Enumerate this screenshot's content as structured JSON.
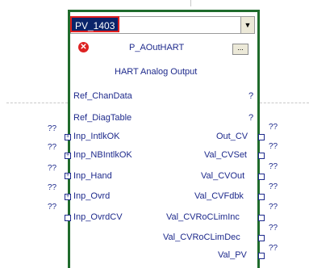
{
  "block": {
    "tag_name": "PV_1403",
    "block_type": "P_AOutHART",
    "description": "HART Analog Output",
    "config_button_label": "...",
    "dropdown_arrow": "▼",
    "error_icon": "x-circle-icon"
  },
  "params": [
    {
      "label": "Ref_ChanData",
      "value": "?"
    },
    {
      "label": "Ref_DiagTable",
      "value": "?"
    }
  ],
  "inputs": [
    {
      "label": "Inp_IntlkOK",
      "wire": "??"
    },
    {
      "label": "Inp_NBIntlkOK",
      "wire": "??"
    },
    {
      "label": "Inp_Hand",
      "wire": "??"
    },
    {
      "label": "Inp_Ovrd",
      "wire": "??"
    },
    {
      "label": "Inp_OvrdCV",
      "wire": "??"
    }
  ],
  "outputs": [
    {
      "label": "Out_CV",
      "wire": "??"
    },
    {
      "label": "Val_CVSet",
      "wire": "??"
    },
    {
      "label": "Val_CVOut",
      "wire": "??"
    },
    {
      "label": "Val_CVFdbk",
      "wire": "??"
    },
    {
      "label": "Val_CVRoCLimInc",
      "wire": "??"
    },
    {
      "label": "Val_CVRoCLimDec",
      "wire": "??"
    },
    {
      "label": "Val_PV",
      "wire": "??"
    }
  ]
}
